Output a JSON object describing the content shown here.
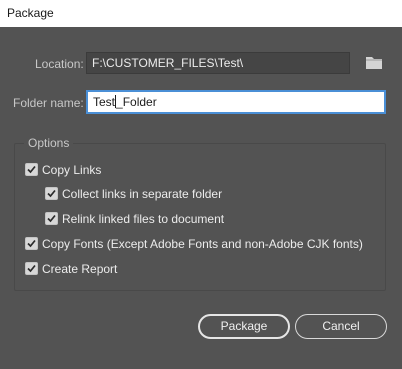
{
  "window": {
    "title": "Package"
  },
  "location": {
    "label": "Location:",
    "value": "F:\\CUSTOMER_FILES\\Test\\"
  },
  "folder_name": {
    "label": "Folder name:",
    "value_before_caret": "Test",
    "value_after_caret": "_Folder"
  },
  "options": {
    "legend": "Options",
    "copy_links": {
      "label": "Copy Links",
      "checked": true
    },
    "collect_links": {
      "label": "Collect links in separate folder",
      "checked": true
    },
    "relink": {
      "label": "Relink linked files to document",
      "checked": true
    },
    "copy_fonts": {
      "label": "Copy Fonts (Except Adobe Fonts and non-Adobe CJK fonts)",
      "checked": true
    },
    "create_report": {
      "label": "Create Report",
      "checked": true
    }
  },
  "buttons": {
    "package": "Package",
    "cancel": "Cancel"
  },
  "icons": {
    "browse": "folder-icon",
    "check": "checkmark-icon"
  },
  "colors": {
    "dialog_bg": "#535353",
    "focus_ring": "#4a8fd6"
  }
}
